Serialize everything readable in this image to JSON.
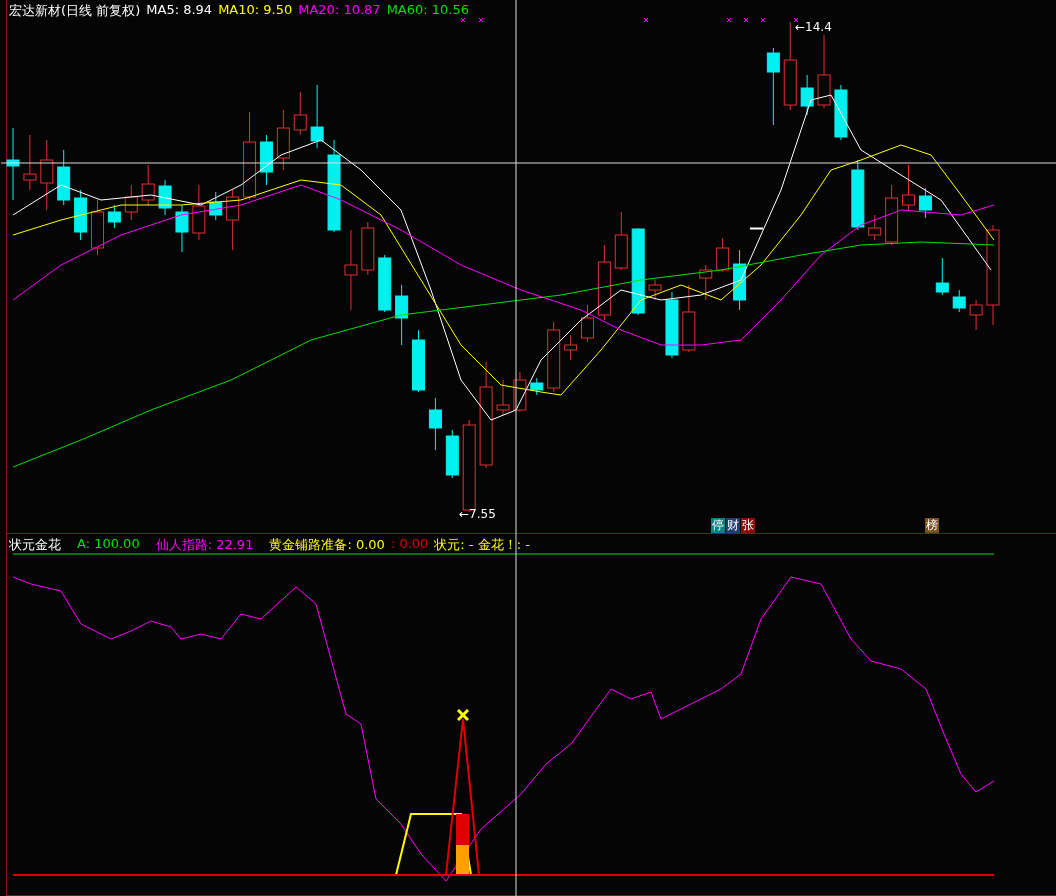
{
  "main_pane": {
    "title": "宏达新材(日线 前复权)",
    "legend": [
      {
        "label": "MA5: 8.94",
        "color": "#ffffff"
      },
      {
        "label": "MA10: 9.50",
        "color": "#ffff00"
      },
      {
        "label": "MA20: 10.87",
        "color": "#ff00ff"
      },
      {
        "label": "MA60: 10.56",
        "color": "#00e000"
      }
    ],
    "price_labels": [
      {
        "text": "←14.4",
        "kind": "high"
      },
      {
        "text": "←7.55",
        "kind": "low"
      }
    ],
    "badges": [
      {
        "text": "停",
        "color": "#138080"
      },
      {
        "text": "财",
        "color": "#1f3f6f"
      },
      {
        "text": "张",
        "color": "#8a1010"
      },
      {
        "text": "榜",
        "color": "#7a5020"
      }
    ]
  },
  "indicator_pane": {
    "title": "状元金花",
    "legend": [
      {
        "label": "A: 100.00",
        "color": "#00e000"
      },
      {
        "label": "仙人指路: 22.91",
        "color": "#ff00ff"
      },
      {
        "label": "黄金铺路准备: 0.00",
        "color": "#ffff00"
      },
      {
        "label": ": 0.00",
        "color": "#e00000"
      },
      {
        "label": "状元: - 金花！: -",
        "color": "#ffff00"
      }
    ]
  }
}
